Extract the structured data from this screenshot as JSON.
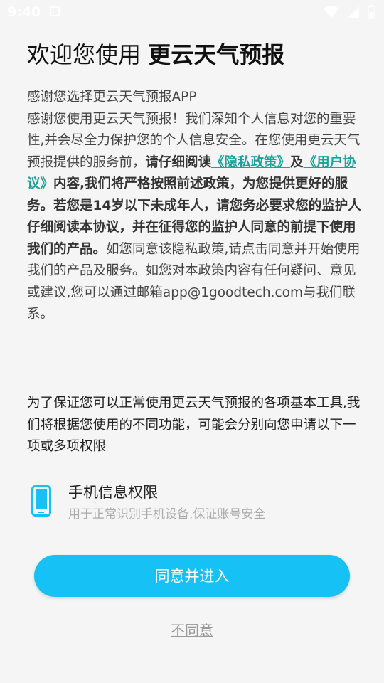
{
  "status_bar": {
    "time": "9:40",
    "icons": [
      "notification-icon",
      "wifi-icon",
      "signal-icon",
      "battery-icon"
    ]
  },
  "title": {
    "prefix": "欢迎您使用 ",
    "brand": "更云天气预报"
  },
  "intro": {
    "line1": "感谢您选择更云天气预报APP",
    "p1": "感谢您使用更云天气预报！我们深知个人信息对您的重要性,并会尽全力保护您的个人信息安全。在您使用更云天气预报提供的服务前，",
    "bold1": "请仔细阅读",
    "privacy_link": "《隐私政策》",
    "and_text": "及",
    "user_link": "《用户协议》",
    "bold2": "内容,我们将严格按照前述政策，为您提供更好的服务。若您是14岁以下未成年人，请您务必要求您的监护人仔细阅读本协议，并在征得您的监护人同意的前提下使用我们的产品。",
    "p2": "如您同意该隐私政策,请点击同意并开始使用我们的产品及服务。如您对本政策内容有任何疑问、意见或建议,您可以通过邮箱app@1goodtech.com与我们联系。"
  },
  "permissions_intro": "为了保证您可以正常使用更云天气预报的各项基本工具,我们将根据您使用的不同功能，可能会分别向您申请以下一项或多项权限",
  "permission": {
    "icon": "phone-icon",
    "title": "手机信息权限",
    "description": "用于正常识别手机设备,保证账号安全"
  },
  "buttons": {
    "agree": "同意并进入",
    "disagree": "不同意"
  },
  "colors": {
    "accent": "#15c1f5",
    "link": "#1aa39a",
    "background": "#f5f5f5"
  }
}
